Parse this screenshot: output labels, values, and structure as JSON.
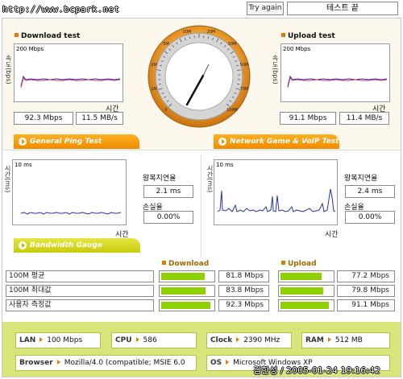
{
  "header": {
    "url": "http://www.bcpark.net",
    "try_again": "Try again",
    "status": "테스트 끝"
  },
  "download": {
    "title": "Download test",
    "y_axis": "속도(bps)",
    "max_label": "200 Mbps",
    "time_label": "시간",
    "mbps": "92.3 Mbps",
    "mbs": "11.5 MB/s"
  },
  "upload": {
    "title": "Upload test",
    "y_axis": "속도(bps)",
    "max_label": "200 Mbps",
    "time_label": "시간",
    "mbps": "91.1 Mbps",
    "mbs": "11.4 MB/s"
  },
  "gauge": {
    "ticks": [
      "0",
      "1M",
      "2M",
      "5M",
      "10M",
      "20M",
      "30M",
      "50M",
      "70M",
      "100M"
    ],
    "needle_value": "92.3 Mbps"
  },
  "tabs": {
    "ping": "General Ping Test",
    "game": "Network Game & VoIP Test",
    "bandwidth": "Bandwidth Gauge"
  },
  "ping_general": {
    "y_axis": "시간(ms)",
    "max_label": "10 ms",
    "time_label": "시간",
    "rtt_label": "왕복지연율",
    "rtt": "2.1 ms",
    "loss_label": "손실율",
    "loss": "0.00%"
  },
  "ping_game": {
    "y_axis": "시간(ms)",
    "max_label": "10 ms",
    "time_label": "시간",
    "rtt_label": "왕복지연율",
    "rtt": "2.4 ms",
    "loss_label": "손실율",
    "loss": "0.00%"
  },
  "bandwidth": {
    "download_header": "Download",
    "upload_header": "Upload",
    "rows": [
      {
        "label": "100M 평균",
        "download": "81.8 Mbps",
        "download_pct": 81.8,
        "upload": "77.2 Mbps",
        "upload_pct": 77.2
      },
      {
        "label": "100M 최대값",
        "download": "83.8 Mbps",
        "download_pct": 83.8,
        "upload": "79.8 Mbps",
        "upload_pct": 79.8
      },
      {
        "label": "사용자 측정값",
        "download": "92.3 Mbps",
        "download_pct": 92.3,
        "upload": "91.1 Mbps",
        "upload_pct": 91.1
      }
    ]
  },
  "system": {
    "lan_k": "LAN",
    "lan": "100 Mbps",
    "cpu_k": "CPU",
    "cpu": "586",
    "clock_k": "Clock",
    "clock": "2390 MHz",
    "ram_k": "RAM",
    "ram": "512 MB",
    "browser_k": "Browser",
    "browser": "Mozilla/4.0 (compatible; MSIE 6.0",
    "os_k": "OS",
    "os": "Microsoft Windows XP"
  },
  "watermark": "김한성 / 2005-01-24 19:16:42",
  "colors": {
    "tab_orange": "#f08a00",
    "tab_yellow": "#c9cb0a",
    "bar_green": "#8fd000",
    "panel_bg": "#fbf7ec",
    "sys_bg": "#d9e57a"
  }
}
